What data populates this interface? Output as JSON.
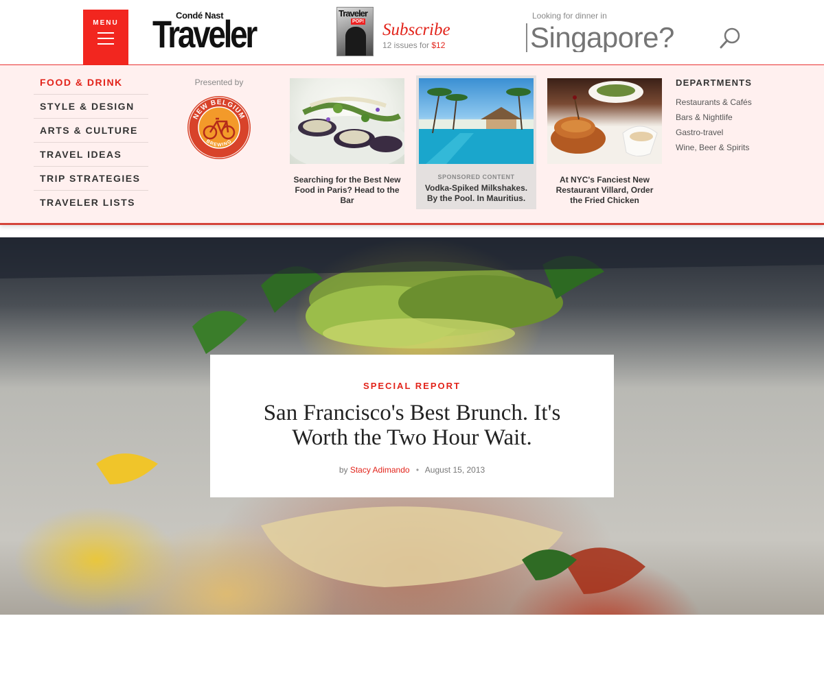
{
  "header": {
    "menu_label": "MENU",
    "logo": {
      "top": "Condé Nast",
      "main": "Traveler"
    },
    "magazine": {
      "title": "Traveler",
      "tag": "POP!"
    },
    "subscribe": {
      "title": "Subscribe",
      "offer": "12 issues for ",
      "price": "$12"
    },
    "dinner": {
      "label": "Looking for dinner in",
      "placeholder": "Singapore?"
    }
  },
  "dropdown": {
    "nav": [
      {
        "label": "FOOD & DRINK",
        "active": true
      },
      {
        "label": "STYLE & DESIGN"
      },
      {
        "label": "ARTS & CULTURE"
      },
      {
        "label": "TRAVEL IDEAS"
      },
      {
        "label": "TRIP STRATEGIES"
      },
      {
        "label": "TRAVELER LISTS"
      }
    ],
    "presented_by": "Presented by",
    "sponsor": {
      "top": "NEW BELGIUM",
      "bottom": "BREWING"
    },
    "cards": [
      {
        "title": "Searching for the Best New Food in Paris? Head to the Bar"
      },
      {
        "tag": "SPONSORED CONTENT",
        "title": "Vodka-Spiked Milkshakes. By the Pool. In Mauritius."
      },
      {
        "title": "At NYC's Fanciest New Restaurant Villard, Order the Fried Chicken"
      }
    ],
    "departments": {
      "title": "DEPARTMENTS",
      "items": [
        "Restaurants & Cafés",
        "Bars & Nightlife",
        "Gastro-travel",
        "Wine, Beer & Spirits"
      ]
    }
  },
  "story": {
    "kicker": "SPECIAL REPORT",
    "headline": "San Francisco's Best Brunch. It's Worth the Two Hour Wait.",
    "by": "by",
    "author": "Stacy Adimando",
    "date": "August 15, 2013"
  },
  "colors": {
    "accent": "#e2231a",
    "dropdown_bg": "#fff0ef"
  }
}
